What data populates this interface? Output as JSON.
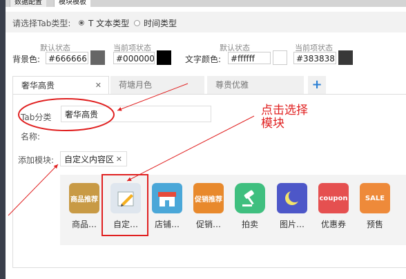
{
  "top_tabs": [
    "数据配置",
    "模块模板"
  ],
  "tab_type": {
    "prompt": "请选择Tab类型:",
    "options": [
      "T 文本类型",
      "时间类型"
    ],
    "selected": "T 文本类型"
  },
  "bg_color": {
    "label": "背景色:",
    "default_label": "默认状态",
    "default_value": "#666666",
    "current_label": "当前项状态",
    "current_value": "#000000"
  },
  "text_color": {
    "label": "文字颜色:",
    "default_label": "默认状态",
    "default_value": "#ffffff",
    "current_label": "当前项状态",
    "current_value": "#383838"
  },
  "swatches": {
    "bg_default": "#666666",
    "bg_current": "#000000",
    "text_default": "#ffffff",
    "text_current": "#383838"
  },
  "module_tabs": [
    {
      "label": "奢华高贵",
      "close": "✕"
    },
    {
      "label": "荷塘月色"
    },
    {
      "label": "尊贵优雅"
    }
  ],
  "add_tab_icon": "+",
  "form": {
    "tab_name_label": "Tab分类名称:",
    "tab_name_value": "奢华高贵",
    "add_module_label": "添加模块:",
    "added_module": "自定义内容区",
    "added_module_remove": "✕"
  },
  "annotation": {
    "line1": "点击选择",
    "line2": "模块"
  },
  "modules": [
    {
      "label": "商品…",
      "icon": "goods-recommend-icon",
      "icon_text": "商品推荐",
      "color": "#c89a45"
    },
    {
      "label": "自定…",
      "icon": "pencil-note-icon",
      "icon_text": "",
      "color": "#dfe6ee"
    },
    {
      "label": "店铺…",
      "icon": "shop-icon",
      "icon_text": "",
      "color": "#4aa7d8"
    },
    {
      "label": "促销…",
      "icon": "promotion-icon",
      "icon_text": "促销推荐",
      "color": "#e8892c"
    },
    {
      "label": "拍卖",
      "icon": "auction-hammer-icon",
      "icon_text": "",
      "color": "#3fbf7f"
    },
    {
      "label": "图片…",
      "icon": "image-moon-icon",
      "icon_text": "",
      "color": "#4d57c8"
    },
    {
      "label": "优惠券",
      "icon": "coupon-icon",
      "icon_text": "coupon",
      "color": "#e55050"
    },
    {
      "label": "预售",
      "icon": "sale-tag-icon",
      "icon_text": "SALE",
      "color": "#ee8a3a"
    }
  ]
}
